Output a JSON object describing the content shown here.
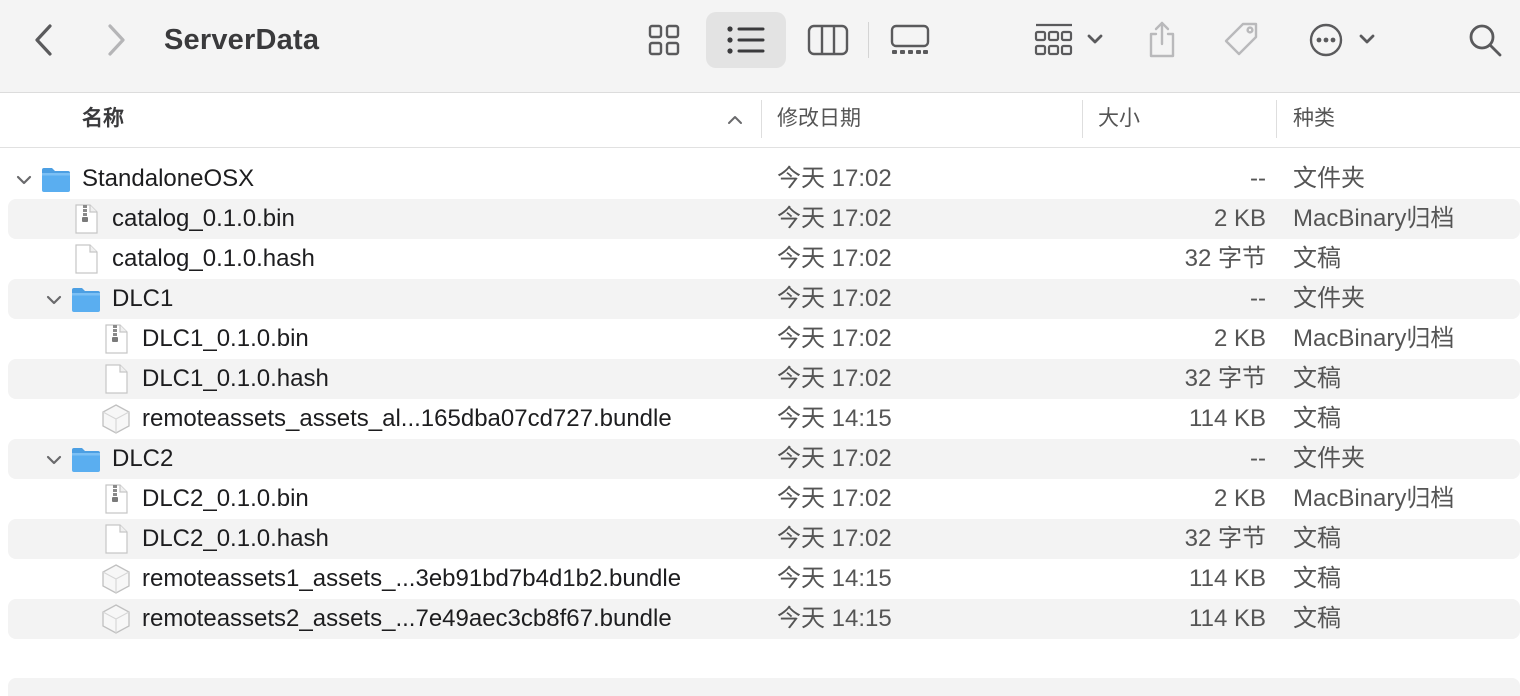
{
  "window": {
    "title": "ServerData"
  },
  "toolbar": {
    "icons": [
      "chevron-left-icon",
      "chevron-right-icon",
      "grid-view-icon",
      "list-view-icon",
      "column-view-icon",
      "gallery-view-icon",
      "group-icon",
      "share-icon",
      "tag-icon",
      "more-icon",
      "search-icon"
    ],
    "active_view": "list"
  },
  "columns": {
    "name": "名称",
    "date": "修改日期",
    "size": "大小",
    "kind": "种类",
    "sort": "ascending"
  },
  "rows": [
    {
      "name": "StandaloneOSX",
      "date": "今天 17:02",
      "size": "--",
      "kind": "文件夹",
      "icon": "folder-icon",
      "level": 0,
      "expanded": true,
      "alt": false
    },
    {
      "name": "catalog_0.1.0.bin",
      "date": "今天 17:02",
      "size": "2 KB",
      "kind": "MacBinary归档",
      "icon": "archive-file-icon",
      "level": 1,
      "alt": true
    },
    {
      "name": "catalog_0.1.0.hash",
      "date": "今天 17:02",
      "size": "32 字节",
      "kind": "文稿",
      "icon": "document-icon",
      "level": 1,
      "alt": false
    },
    {
      "name": "DLC1",
      "date": "今天 17:02",
      "size": "--",
      "kind": "文件夹",
      "icon": "folder-icon",
      "level": 1,
      "expanded": true,
      "alt": true
    },
    {
      "name": "DLC1_0.1.0.bin",
      "date": "今天 17:02",
      "size": "2 KB",
      "kind": "MacBinary归档",
      "icon": "archive-file-icon",
      "level": 2,
      "alt": false
    },
    {
      "name": "DLC1_0.1.0.hash",
      "date": "今天 17:02",
      "size": "32 字节",
      "kind": "文稿",
      "icon": "document-icon",
      "level": 2,
      "alt": true
    },
    {
      "name": "remoteassets_assets_al...165dba07cd727.bundle",
      "date": "今天 14:15",
      "size": "114 KB",
      "kind": "文稿",
      "icon": "bundle-icon",
      "level": 2,
      "alt": false
    },
    {
      "name": "DLC2",
      "date": "今天 17:02",
      "size": "--",
      "kind": "文件夹",
      "icon": "folder-icon",
      "level": 1,
      "expanded": true,
      "alt": true
    },
    {
      "name": "DLC2_0.1.0.bin",
      "date": "今天 17:02",
      "size": "2 KB",
      "kind": "MacBinary归档",
      "icon": "archive-file-icon",
      "level": 2,
      "alt": false
    },
    {
      "name": "DLC2_0.1.0.hash",
      "date": "今天 17:02",
      "size": "32 字节",
      "kind": "文稿",
      "icon": "document-icon",
      "level": 2,
      "alt": true
    },
    {
      "name": "remoteassets1_assets_...3eb91bd7b4d1b2.bundle",
      "date": "今天 14:15",
      "size": "114 KB",
      "kind": "文稿",
      "icon": "bundle-icon",
      "level": 2,
      "alt": false
    },
    {
      "name": "remoteassets2_assets_...7e49aec3cb8f67.bundle",
      "date": "今天 14:15",
      "size": "114 KB",
      "kind": "文稿",
      "icon": "bundle-icon",
      "level": 2,
      "alt": true
    }
  ],
  "colors": {
    "folder": "#5aaef0",
    "folder_tab": "#4c9fe3",
    "toolbar_bg": "#f4f4f4",
    "stripe": "#f3f3f3"
  }
}
